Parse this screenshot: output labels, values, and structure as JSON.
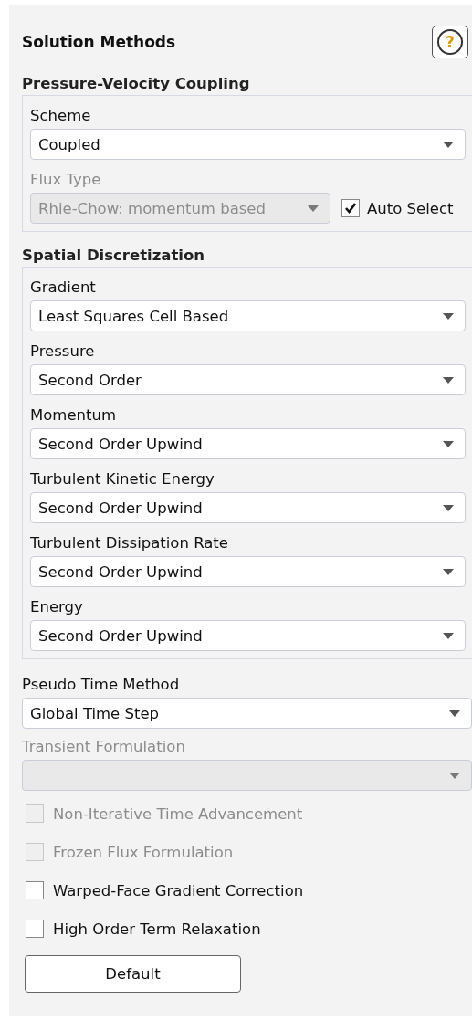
{
  "title": "Solution Methods",
  "help_button": {
    "label": "?"
  },
  "groups": [
    {
      "heading": "Pressure-Velocity Coupling",
      "fields": [
        {
          "label": "Scheme",
          "value": "Coupled",
          "disabled": false
        },
        {
          "label": "Flux Type",
          "value": "Rhie-Chow: momentum based",
          "disabled": true,
          "auto_select": {
            "label": "Auto Select",
            "checked": true
          }
        }
      ]
    },
    {
      "heading": "Spatial Discretization",
      "fields": [
        {
          "label": "Gradient",
          "value": "Least Squares Cell Based",
          "disabled": false
        },
        {
          "label": "Pressure",
          "value": "Second Order",
          "disabled": false
        },
        {
          "label": "Momentum",
          "value": "Second Order Upwind",
          "disabled": false
        },
        {
          "label": "Turbulent Kinetic Energy",
          "value": "Second Order Upwind",
          "disabled": false
        },
        {
          "label": "Turbulent Dissipation Rate",
          "value": "Second Order Upwind",
          "disabled": false
        },
        {
          "label": "Energy",
          "value": "Second Order Upwind",
          "disabled": false
        }
      ]
    }
  ],
  "fields": [
    {
      "label": "Pseudo Time Method",
      "value": "Global Time Step",
      "disabled": false
    },
    {
      "label": "Transient Formulation",
      "disabled": true
    }
  ],
  "options": [
    {
      "label": "Non-Iterative Time Advancement",
      "checked": false,
      "disabled": true
    },
    {
      "label": "Frozen Flux Formulation",
      "checked": false,
      "disabled": true
    },
    {
      "label": "Warped-Face Gradient Correction",
      "checked": false,
      "disabled": false
    },
    {
      "label": "High Order Term Relaxation",
      "checked": false,
      "disabled": false
    }
  ],
  "default_button": "Default"
}
